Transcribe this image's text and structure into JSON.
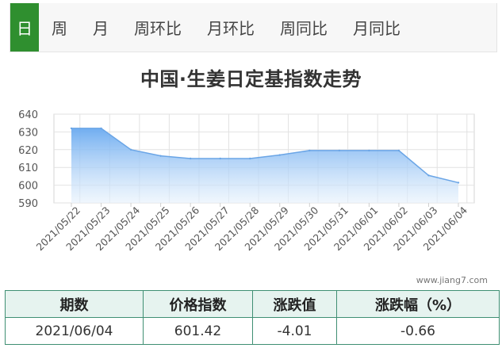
{
  "tabs": [
    "日",
    "周",
    "月",
    "周环比",
    "月环比",
    "周同比",
    "月同比"
  ],
  "active_tab": 0,
  "colors": {
    "accent": "#2f8f2f",
    "area_top": "#6aaaf0",
    "area_bottom": "#e6f1fc",
    "line": "#6aa5e6",
    "table_border": "#3f8f73",
    "table_header_bg": "#e6f3ef"
  },
  "chart_data": {
    "type": "area",
    "title": "中国·生姜日定基指数走势",
    "xlabel": "",
    "ylabel": "",
    "ylim": [
      590,
      640
    ],
    "yticks": [
      590,
      600,
      610,
      620,
      630,
      640
    ],
    "grid": true,
    "categories": [
      "2021/05/22",
      "2021/05/23",
      "2021/05/24",
      "2021/05/25",
      "2021/05/26",
      "2021/05/27",
      "2021/05/28",
      "2021/05/29",
      "2021/05/30",
      "2021/05/31",
      "2021/06/01",
      "2021/06/02",
      "2021/06/03",
      "2021/06/04"
    ],
    "series": [
      {
        "values": [
          632.0,
          632.0,
          620.0,
          616.5,
          615.0,
          615.0,
          615.0,
          617.0,
          619.5,
          619.5,
          619.5,
          619.5,
          605.5,
          601.42
        ]
      }
    ]
  },
  "watermark": "www.jiang7.com",
  "table": {
    "headers": [
      "期数",
      "价格指数",
      "涨跌值",
      "涨跌幅（%）"
    ],
    "rows": [
      [
        "2021/06/04",
        "601.42",
        "-4.01",
        "-0.66"
      ]
    ]
  }
}
